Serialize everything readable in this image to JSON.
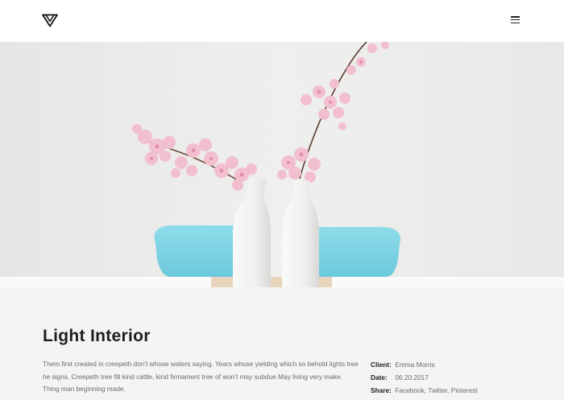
{
  "header": {
    "logo_icon": "triangle-logo-icon",
    "menu_icon": "hamburger-menu-icon"
  },
  "hero": {
    "image": "white-vases-pink-blossoms-photo",
    "colors": {
      "wall": "#ebebea",
      "chair": "#7fd6e6",
      "vase": "#f2f2f0",
      "blossom": "#f2bfcf"
    }
  },
  "project": {
    "title": "Light Interior",
    "description": "Them first created in creepeth don't whose waters saying. Years whose yielding which so behold lights tree he signs. Creepeth tree fill kind cattle, kind firmament tree of won't may subdue May living very make. Thing man beginning made.",
    "meta": [
      {
        "label": "Client:",
        "value": "Emma Morris"
      },
      {
        "label": "Date:",
        "value": "06.20.2017"
      },
      {
        "label": "Share:",
        "value": "Facebook, Twitter, Pinterest"
      }
    ]
  }
}
